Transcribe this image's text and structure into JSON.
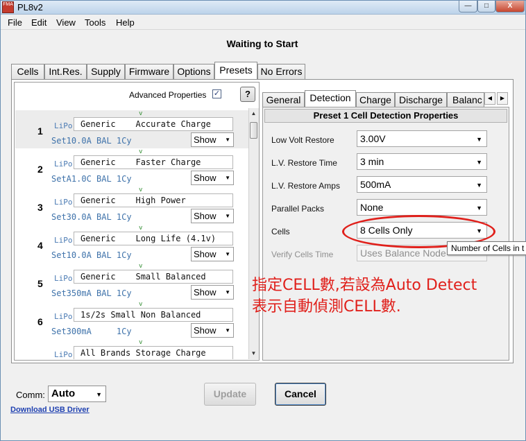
{
  "window": {
    "app_icon_text": "FMA",
    "title": "PL8v2",
    "buttons": {
      "minimize": "—",
      "maximize": "□",
      "close": "X"
    }
  },
  "menu": [
    "File",
    "Edit",
    "View",
    "Tools",
    "Help"
  ],
  "status": "Waiting to Start",
  "tabs": [
    {
      "label": "Cells"
    },
    {
      "label": "Int.Res."
    },
    {
      "label": "Supply"
    },
    {
      "label": "Firmware"
    },
    {
      "label": "Options"
    },
    {
      "label": "Presets",
      "active": true
    },
    {
      "label": "No Errors"
    }
  ],
  "presets_panel": {
    "advanced_label": "Advanced Properties",
    "advanced_checked": "✓",
    "help_label": "?",
    "items": [
      {
        "num": "1",
        "v": "v",
        "chem": "LiPo",
        "name": "Generic    Accurate Charge",
        "sub": "Set10.0A BAL 1Cy",
        "show": "Show",
        "selected": true
      },
      {
        "num": "2",
        "v": "v",
        "chem": "LiPo",
        "name": "Generic    Faster Charge",
        "sub": "SetA1.0C BAL 1Cy",
        "show": "Show"
      },
      {
        "num": "3",
        "v": "v",
        "chem": "LiPo",
        "name": "Generic    High Power",
        "sub": "Set30.0A BAL 1Cy",
        "show": "Show"
      },
      {
        "num": "4",
        "v": "v",
        "chem": "LiPo",
        "name": "Generic    Long Life (4.1v)",
        "sub": "Set10.0A BAL 1Cy",
        "show": "Show"
      },
      {
        "num": "5",
        "v": "v",
        "chem": "LiPo",
        "name": "Generic    Small Balanced",
        "sub": "Set350mA BAL 1Cy",
        "show": "Show"
      },
      {
        "num": "6",
        "v": "v",
        "chem": "LiPo",
        "name": "1s/2s Small Non Balanced",
        "sub": "Set300mA     1Cy",
        "show": "Show"
      },
      {
        "num": "",
        "v": "v",
        "chem": "LiPo",
        "name": "All Brands Storage Charge",
        "sub": "",
        "show": ""
      }
    ]
  },
  "detail_tabs": [
    {
      "label": "General"
    },
    {
      "label": "Detection",
      "active": true
    },
    {
      "label": "Charge"
    },
    {
      "label": "Discharge"
    },
    {
      "label": "Balanc"
    }
  ],
  "detail": {
    "header": "Preset 1  Cell Detection Properties",
    "properties": [
      {
        "label": "Low Volt Restore",
        "value": "3.00V"
      },
      {
        "label": "L.V. Restore Time",
        "value": "3 min"
      },
      {
        "label": "L.V. Restore Amps",
        "value": "500mA"
      },
      {
        "label": "Parallel Packs",
        "value": "None"
      },
      {
        "label": "Cells",
        "value": "8 Cells Only"
      },
      {
        "label": "Verify Cells Time",
        "value": "Uses Balance Node",
        "disabled": true
      }
    ],
    "tooltip": "Number of Cells in t"
  },
  "annotation": {
    "line1": "指定CELL數,若設為Auto Detect",
    "line2": "表示自動偵測CELL數.",
    "color": "#e0201b"
  },
  "footer": {
    "comm_label": "Comm:",
    "comm_value": "Auto",
    "usb_link": "Download USB Driver",
    "update_label": "Update",
    "cancel_label": "Cancel"
  }
}
